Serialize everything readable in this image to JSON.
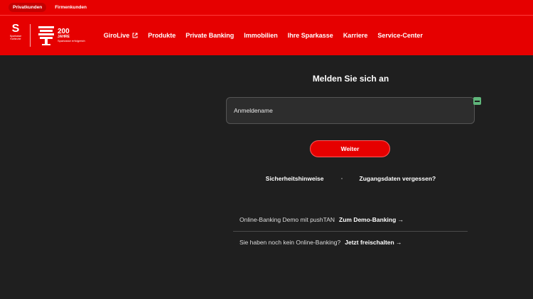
{
  "segments": [
    "Privatkunden",
    "Firmenkunden"
  ],
  "logo": {
    "glyph": "S",
    "tiny": "Sparkasse Karlsruhe",
    "anniv_number": "200",
    "anniv_word": "JAHRE",
    "anniv_sub": "Sparkasse erfolgreich"
  },
  "nav": [
    {
      "label": "GiroLive",
      "external": true
    },
    {
      "label": "Produkte"
    },
    {
      "label": "Private Banking"
    },
    {
      "label": "Immobilien"
    },
    {
      "label": "Ihre Sparkasse"
    },
    {
      "label": "Karriere"
    },
    {
      "label": "Service-Center"
    }
  ],
  "login": {
    "title": "Melden Sie sich an",
    "input_label": "Anmeldename",
    "submit": "Weiter",
    "link_security": "Sicherheitshinweise",
    "link_forgot": "Zugangsdaten vergessen?"
  },
  "demo": {
    "text": "Online-Banking Demo mit pushTAN",
    "link": "Zum Demo-Banking →"
  },
  "activate": {
    "text": "Sie haben noch kein Online-Banking?",
    "link": "Jetzt freischalten →"
  }
}
